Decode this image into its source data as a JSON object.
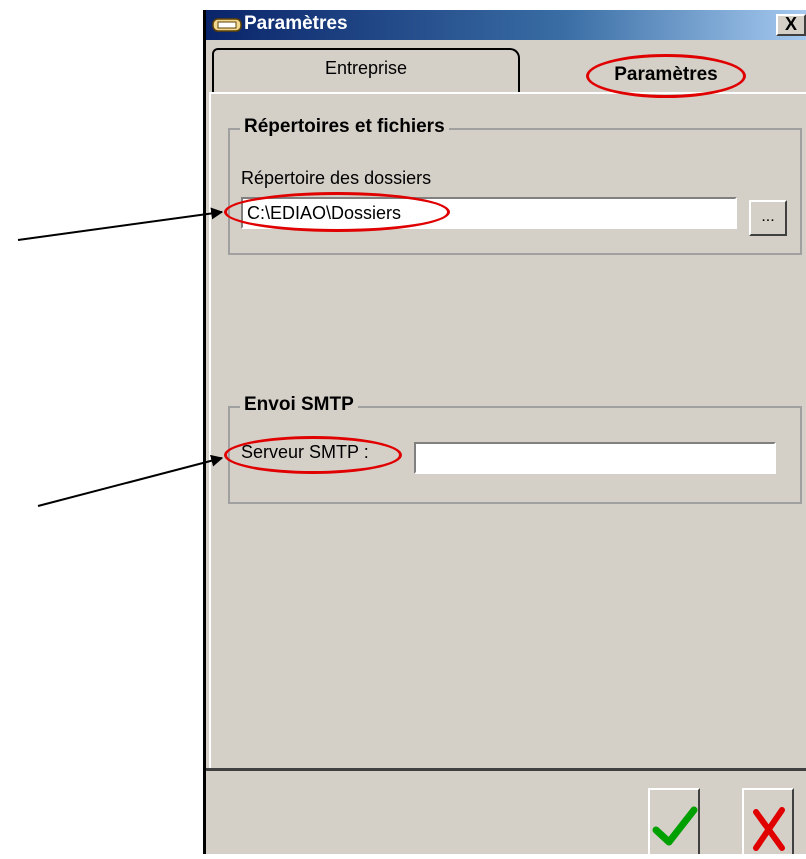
{
  "window": {
    "title": "Paramètres",
    "close_label": "X"
  },
  "tabs": {
    "entreprise": "Entreprise",
    "parametres": "Paramètres"
  },
  "repertoires": {
    "group_title": "Répertoires et fichiers",
    "dossiers_label": "Répertoire des dossiers",
    "dossiers_value": "C:\\EDIAO\\Dossiers",
    "browse_label": "..."
  },
  "smtp": {
    "group_title": "Envoi SMTP",
    "server_label": "Serveur SMTP :",
    "server_value": ""
  },
  "actions": {
    "ok_icon": "checkmark-icon",
    "cancel_icon": "cross-icon"
  },
  "annotation_color": "#e00000"
}
